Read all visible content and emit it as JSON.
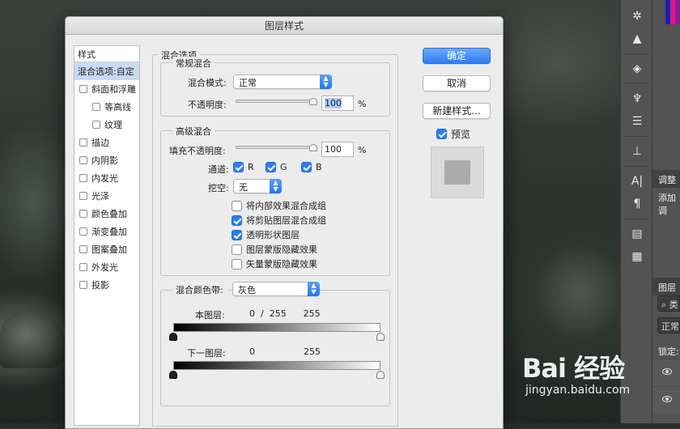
{
  "dialog": {
    "title": "图层样式",
    "styles_header": "样式",
    "styles": [
      {
        "label": "混合选项:自定",
        "selected": true,
        "checkbox": false,
        "checked": false,
        "indent": false
      },
      {
        "label": "斜面和浮雕",
        "selected": false,
        "checkbox": true,
        "checked": false,
        "indent": false
      },
      {
        "label": "等高线",
        "selected": false,
        "checkbox": true,
        "checked": false,
        "indent": true
      },
      {
        "label": "纹理",
        "selected": false,
        "checkbox": true,
        "checked": false,
        "indent": true
      },
      {
        "label": "描边",
        "selected": false,
        "checkbox": true,
        "checked": false,
        "indent": false
      },
      {
        "label": "内阴影",
        "selected": false,
        "checkbox": true,
        "checked": false,
        "indent": false
      },
      {
        "label": "内发光",
        "selected": false,
        "checkbox": true,
        "checked": false,
        "indent": false
      },
      {
        "label": "光泽",
        "selected": false,
        "checkbox": true,
        "checked": false,
        "indent": false
      },
      {
        "label": "颜色叠加",
        "selected": false,
        "checkbox": true,
        "checked": false,
        "indent": false
      },
      {
        "label": "渐变叠加",
        "selected": false,
        "checkbox": true,
        "checked": false,
        "indent": false
      },
      {
        "label": "图案叠加",
        "selected": false,
        "checkbox": true,
        "checked": false,
        "indent": false
      },
      {
        "label": "外发光",
        "selected": false,
        "checkbox": true,
        "checked": false,
        "indent": false
      },
      {
        "label": "投影",
        "selected": false,
        "checkbox": true,
        "checked": false,
        "indent": false
      }
    ],
    "blend_options_title": "混合选项",
    "general": {
      "title": "常规混合",
      "mode_label": "混合模式:",
      "mode_value": "正常",
      "opacity_label": "不透明度:",
      "opacity_value": "100",
      "opacity_level": 1.0,
      "percent": "%"
    },
    "advanced": {
      "title": "高级混合",
      "fill_label": "填充不透明度:",
      "fill_value": "100",
      "fill_level": 1.0,
      "percent": "%",
      "channels_label": "通道:",
      "channels": [
        {
          "label": "R",
          "checked": true
        },
        {
          "label": "G",
          "checked": true
        },
        {
          "label": "B",
          "checked": true
        }
      ],
      "knockout_label": "挖空:",
      "knockout_value": "无",
      "options": [
        {
          "label": "将内部效果混合成组",
          "checked": false
        },
        {
          "label": "将剪贴图层混合成组",
          "checked": true
        },
        {
          "label": "透明形状图层",
          "checked": true
        },
        {
          "label": "图层蒙版隐藏效果",
          "checked": false
        },
        {
          "label": "矢量蒙版隐藏效果",
          "checked": false
        }
      ]
    },
    "blend_if": {
      "label": "混合颜色带:",
      "value": "灰色",
      "this_layer_label": "本图层:",
      "this_layer_values": "0  /  255      255",
      "under_layer_label": "下一图层:",
      "under_layer_low": "0",
      "under_layer_high": "255"
    },
    "buttons": {
      "ok": "确定",
      "cancel": "取消",
      "new_style": "新建样式...",
      "preview_label": "预览",
      "preview_checked": true
    }
  },
  "right_panel": {
    "adjust_tab": "调整",
    "adjust_text": "添加调",
    "layers_tab": "图层",
    "search_placeholder": "类",
    "blend_mode": "正常",
    "lock_label": "锁定:"
  },
  "tool_icons": [
    "settings-gear-icon",
    "histogram-icon",
    "3d-cube-icon",
    "brush-icon",
    "presets-icon",
    "stamp-icon",
    "character-icon",
    "paragraph-icon",
    "notes-icon",
    "glyph-icon"
  ],
  "watermark": {
    "logo": "Bai 经验",
    "url": "jingyan.baidu.com"
  }
}
